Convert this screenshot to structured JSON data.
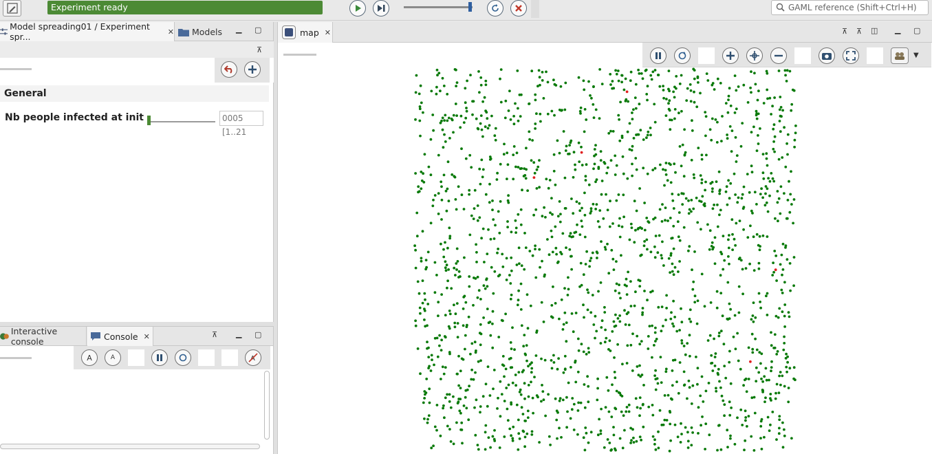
{
  "toolbar": {
    "status_text": "Experiment ready",
    "search_placeholder": "GAML reference (Shift+Ctrl+H)",
    "icons": [
      "pencil-icon",
      "play-icon",
      "step-icon",
      "reload-icon",
      "close-icon"
    ]
  },
  "left_panel": {
    "tabs": [
      {
        "label": "Model spreading01 / Experiment spr...",
        "active": true
      },
      {
        "label": "Models",
        "active": false
      }
    ],
    "section_title": "General",
    "parameters": [
      {
        "label": "Nb people infected at init",
        "value": "0005 [1..21",
        "slider_fraction": 0.02
      }
    ]
  },
  "console_panel": {
    "tabs": [
      {
        "label": "Interactive console",
        "active": false
      },
      {
        "label": "Console",
        "active": true
      }
    ]
  },
  "map_panel": {
    "tab_label": "map",
    "colors": {
      "healthy": "#0a7a0a",
      "infected": "#e02020",
      "status_green": "#4c8a35"
    },
    "counts": {
      "healthy_visible": 1800,
      "infected": 5
    }
  }
}
